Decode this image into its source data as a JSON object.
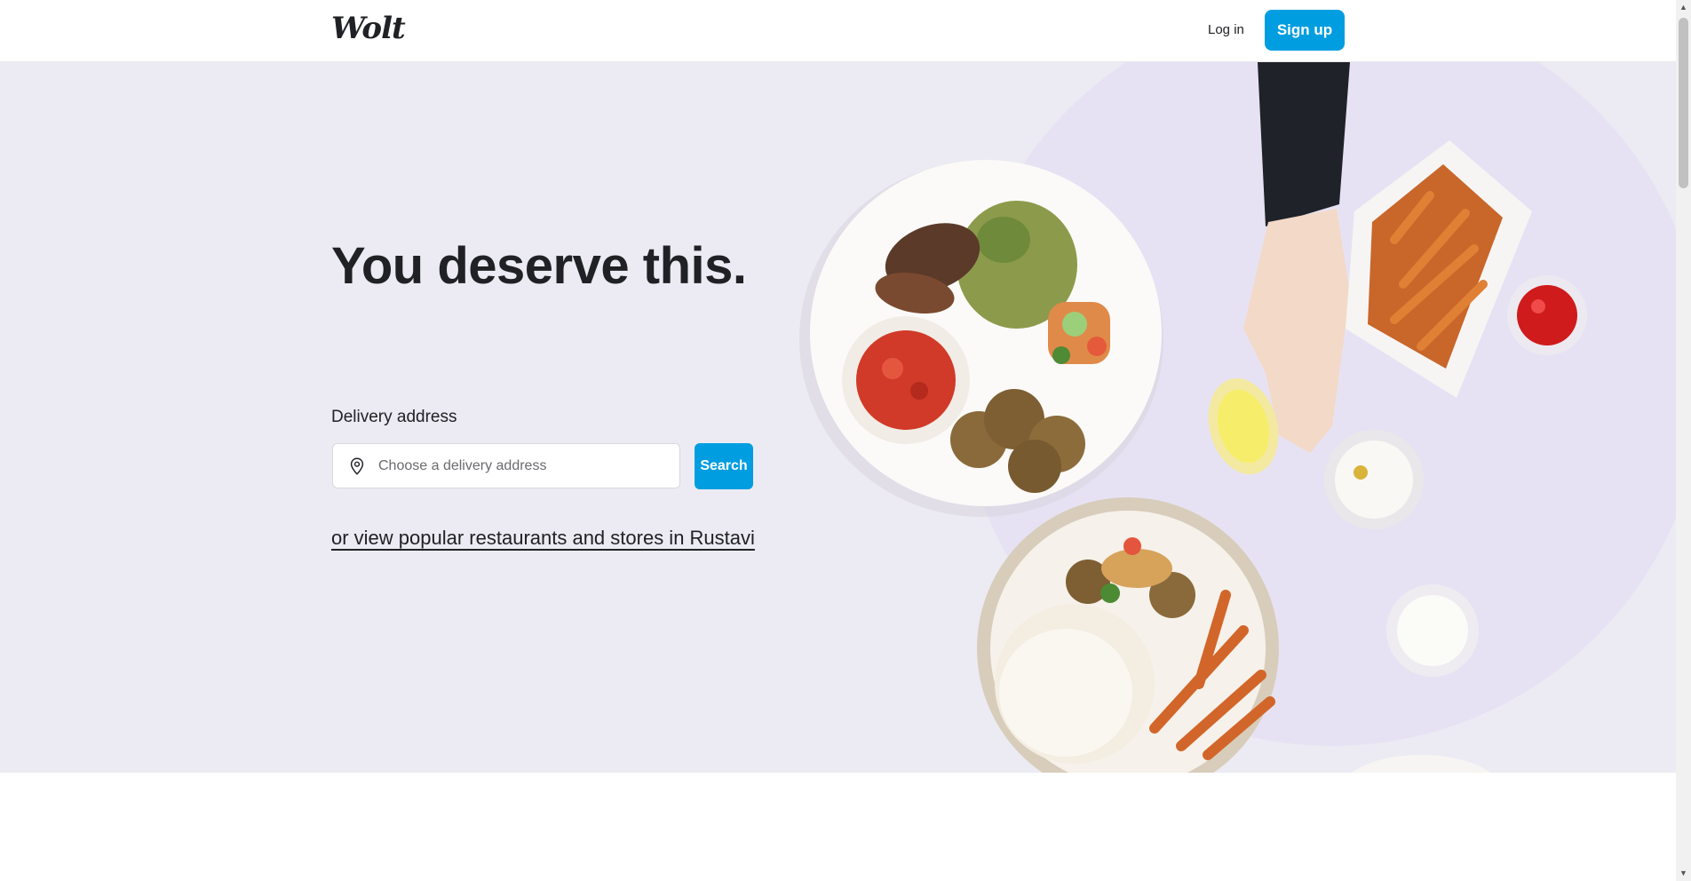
{
  "header": {
    "logo_text": "Wolt",
    "login_label": "Log in",
    "signup_label": "Sign up"
  },
  "hero": {
    "headline": "You deserve this.",
    "address_label": "Delivery address",
    "address_placeholder": "Choose a delivery address",
    "search_label": "Search",
    "popular_link": "or view popular restaurants and stores in Rustavi"
  },
  "colors": {
    "brand": "#009de0",
    "hero_background": "#ecebf3",
    "text": "#202125"
  },
  "icons": [
    "location-pin-icon",
    "chevron-up-icon",
    "chevron-down-icon"
  ]
}
